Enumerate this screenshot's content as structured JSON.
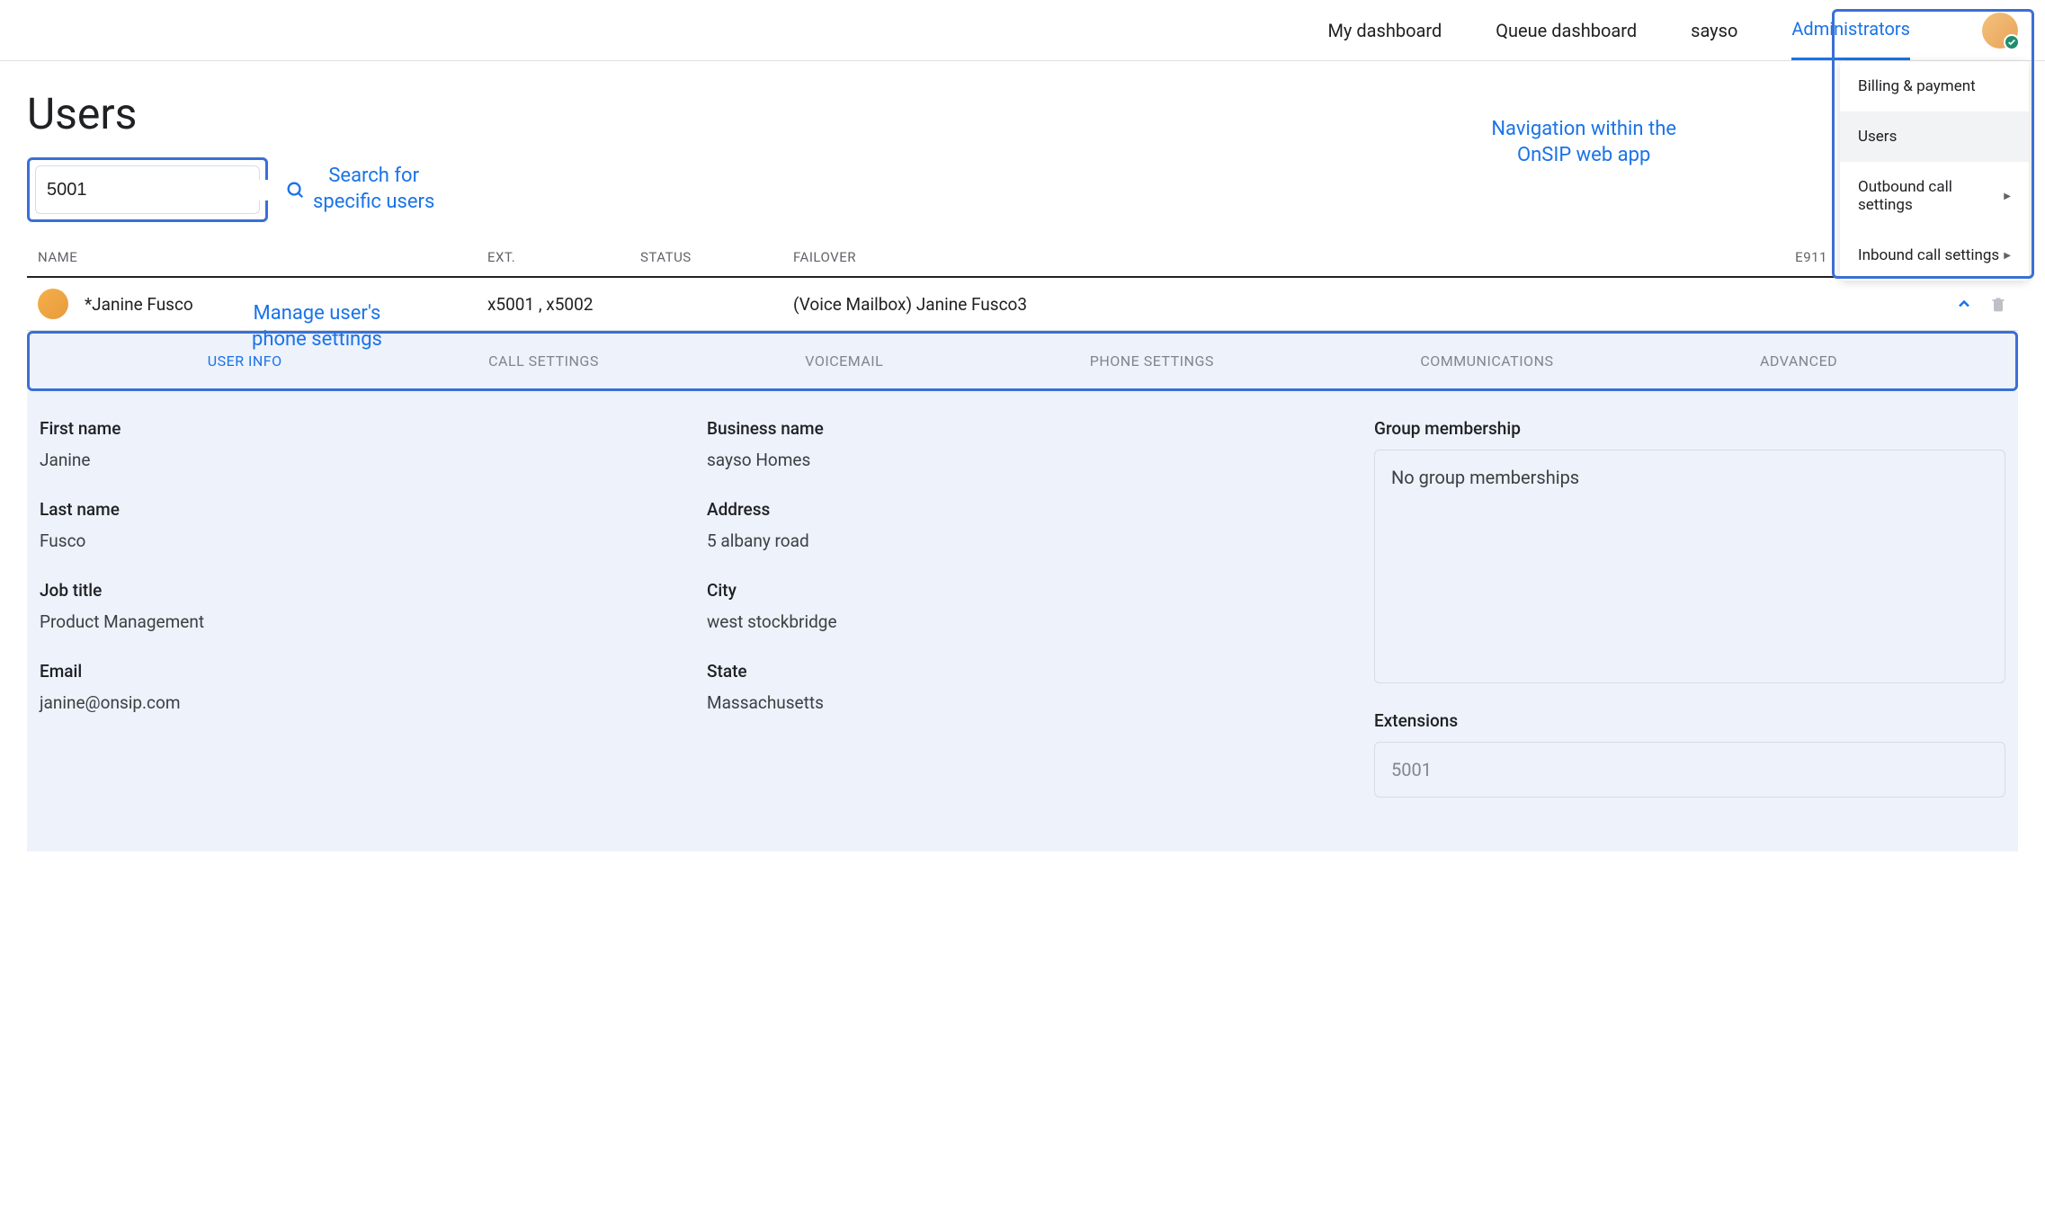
{
  "nav": {
    "items": [
      {
        "label": "My dashboard"
      },
      {
        "label": "Queue dashboard"
      },
      {
        "label": "sayso"
      },
      {
        "label": "Administrators"
      }
    ]
  },
  "dropdown": {
    "items": [
      {
        "label": "Billing & payment"
      },
      {
        "label": "Users"
      },
      {
        "label": "Outbound call settings"
      },
      {
        "label": "Inbound call settings"
      }
    ]
  },
  "page_title": "Users",
  "search": {
    "value": "5001"
  },
  "annotations": {
    "search": "Search for\nspecific users",
    "nav": "Navigation within the\nOnSIP web app",
    "row": "Manage user's\nphone settings"
  },
  "table": {
    "headers": {
      "name": "NAME",
      "ext": "EXT.",
      "status": "STATUS",
      "failover": "FAILOVER",
      "e911": "E911"
    },
    "row": {
      "name": "*Janine Fusco",
      "ext": "x5001 ,  x5002",
      "failover": "(Voice Mailbox) Janine Fusco3"
    }
  },
  "tabs": [
    "USER INFO",
    "CALL SETTINGS",
    "VOICEMAIL",
    "PHONE SETTINGS",
    "COMMUNICATIONS",
    "ADVANCED"
  ],
  "details": {
    "first_name_label": "First name",
    "first_name": "Janine",
    "last_name_label": "Last name",
    "last_name": "Fusco",
    "job_title_label": "Job title",
    "job_title": "Product Management",
    "email_label": "Email",
    "email": "janine@onsip.com",
    "business_name_label": "Business name",
    "business_name": "sayso Homes",
    "address_label": "Address",
    "address": "5 albany road",
    "city_label": "City",
    "city": "west stockbridge",
    "state_label": "State",
    "state": "Massachusetts",
    "group_label": "Group membership",
    "group_empty": "No group memberships",
    "extensions_label": "Extensions",
    "extensions_value": "5001"
  }
}
